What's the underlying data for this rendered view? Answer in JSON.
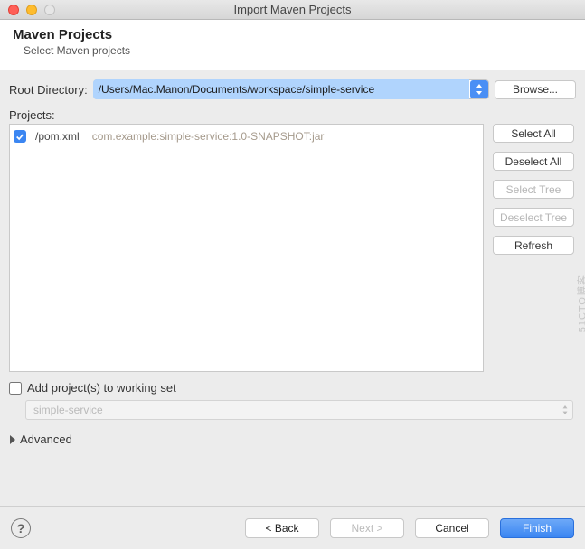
{
  "window": {
    "title": "Import Maven Projects"
  },
  "banner": {
    "heading": "Maven Projects",
    "sub": "Select Maven projects"
  },
  "rootDir": {
    "label": "Root Directory:",
    "value": "/Users/Mac.Manon/Documents/workspace/simple-service",
    "browse": "Browse..."
  },
  "projects": {
    "label": "Projects:",
    "items": [
      {
        "checked": true,
        "file": "/pom.xml",
        "artifact": "com.example:simple-service:1.0-SNAPSHOT:jar"
      }
    ],
    "buttons": {
      "selectAll": "Select All",
      "deselectAll": "Deselect All",
      "selectTree": "Select Tree",
      "deselectTree": "Deselect Tree",
      "refresh": "Refresh"
    }
  },
  "workingSet": {
    "label": "Add project(s) to working set",
    "value": "simple-service"
  },
  "advanced": {
    "label": "Advanced"
  },
  "footer": {
    "back": "< Back",
    "next": "Next >",
    "cancel": "Cancel",
    "finish": "Finish"
  },
  "watermark": "51CTO博客"
}
